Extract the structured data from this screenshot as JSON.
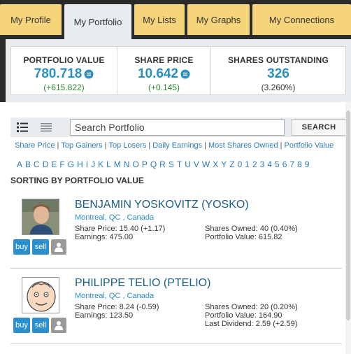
{
  "tabs": [
    {
      "label": "My Profile"
    },
    {
      "label": "My Portfolio"
    },
    {
      "label": "My Lists"
    },
    {
      "label": "My Graphs"
    },
    {
      "label": "My Connections"
    }
  ],
  "active_tab": "My Portfolio",
  "stats": [
    {
      "label": "PORTFOLIO VALUE",
      "value": "780.718",
      "change": "(+615.822)",
      "currency_icon": "coin-icon"
    },
    {
      "label": "SHARE PRICE",
      "value": "10.642",
      "change": "(+0.145)",
      "currency_icon": "coin-icon"
    },
    {
      "label": "SHARES OUTSTANDING",
      "value": "326",
      "change": "(3.260%)"
    }
  ],
  "search": {
    "placeholder": "Search Portfolio",
    "button": "SEARCH"
  },
  "view_icons": [
    "list-view-icon",
    "compact-view-icon"
  ],
  "filters": [
    "Share Price",
    "Top Gainers",
    "Top Losers",
    "Daily Earnings",
    "Most Shares Owned",
    "Portfolio Value"
  ],
  "alphabet": [
    "A",
    "B",
    "C",
    "D",
    "E",
    "F",
    "G",
    "H",
    "I",
    "J",
    "K",
    "L",
    "M",
    "N",
    "O",
    "P",
    "Q",
    "R",
    "S",
    "T",
    "U",
    "V",
    "W",
    "X",
    "Y",
    "Z",
    "0",
    "1",
    "2",
    "3",
    "4",
    "5",
    "6",
    "7",
    "8",
    "9"
  ],
  "sorting_label": "SORTING BY PORTFOLIO VALUE",
  "actions": {
    "buy": "buy",
    "sell": "sell"
  },
  "users": [
    {
      "name": "BENJAMIN YOSKOVITZ",
      "handle": "(YOSKO)",
      "location": "Montreal, QC , Canada",
      "share_price": "Share Price: 15.40 (+1.17)",
      "earnings": "Earnings: 475.00",
      "shares_owned": "Shares Owned: 40 (0.40%)",
      "portfolio_value": "Portfolio Value: 615.82"
    },
    {
      "name": "PHILIPPE TELIO",
      "handle": "(PTELIO)",
      "location": "Montreal, QC , Canada",
      "share_price": "Share Price: 8.24 (-0.59)",
      "earnings": "Earnings: 123.50",
      "shares_owned": "Shares Owned: 20 (0.20%)",
      "portfolio_value": "Portfolio Value: 164.90",
      "last_dividend": "Last Dividend: 2.59 (+2.59)"
    }
  ],
  "colors": {
    "accent_blue": "#2a8fc2",
    "tab_yellow": "#f6d47a",
    "positive_green": "#2f8a2f"
  }
}
